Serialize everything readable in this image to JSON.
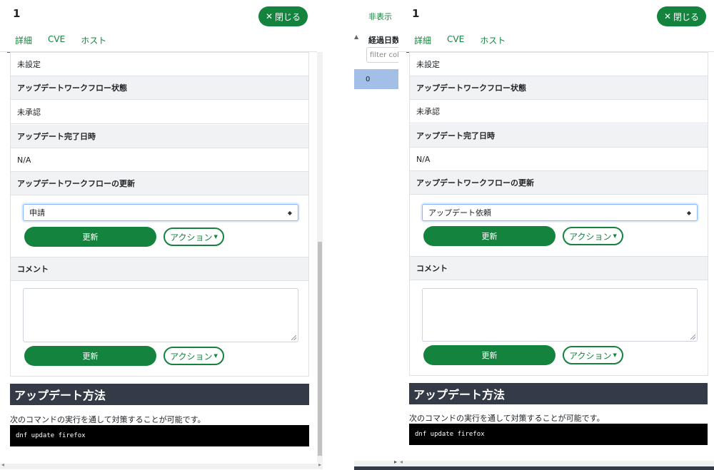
{
  "left": {
    "title": "1",
    "close_label": "閉じる",
    "tabs": [
      "詳細",
      "CVE",
      "ホスト"
    ],
    "rows": [
      "未設定",
      "アップデートワークフロー状態",
      "未承認",
      "アップデート完了日時",
      "N/A",
      "アップデートワークフローの更新"
    ],
    "select_value": "申請",
    "update_label": "更新",
    "action_label": "アクション",
    "comment_label": "コメント",
    "section_title": "アップデート方法",
    "description": "次のコマンドの実行を通して対策することが可能です。",
    "command": "dnf update firefox"
  },
  "middle": {
    "hide_label": "非表示",
    "column_header": "経過日数",
    "filter_placeholder": "filter colu",
    "cell_value": "0"
  },
  "right": {
    "title": "1",
    "close_label": "閉じる",
    "tabs": [
      "詳細",
      "CVE",
      "ホスト"
    ],
    "rows": [
      "未設定",
      "アップデートワークフロー状態",
      "未承認",
      "アップデート完了日時",
      "N/A",
      "アップデートワークフローの更新"
    ],
    "select_value": "アップデート依頼",
    "update_label": "更新",
    "action_label": "アクション",
    "comment_label": "コメント",
    "section_title": "アップデート方法",
    "description": "次のコマンドの実行を通して対策することが可能です。",
    "command": "dnf update firefox"
  },
  "colors": {
    "accent": "#13833d",
    "section_bg": "#343a46",
    "selected_cell": "#a3bfe8"
  }
}
